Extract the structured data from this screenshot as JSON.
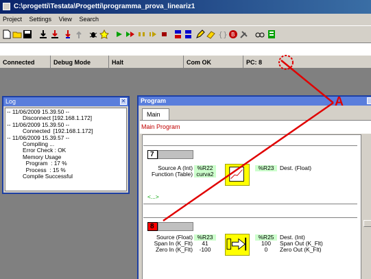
{
  "window": {
    "title": "C:\\progetti\\Testata\\Progetti\\programma_prova_lineariz1"
  },
  "menu": [
    "Project",
    "Settings",
    "View",
    "Search"
  ],
  "toolbar": {
    "icons": [
      "new-file-icon",
      "open-folder-icon",
      "save-icon",
      "download-icon",
      "download-options-icon",
      "compile-icon",
      "upload-icon",
      "debug-bug-icon",
      "star-icon",
      "run-icon",
      "step-icon",
      "pause-icon",
      "step-over-icon",
      "stop-icon",
      "breakpoint-icon",
      "breakpoint-clear-icon",
      "pencil-icon",
      "eraser-icon",
      "brackets-icon",
      "record-icon",
      "tools-icon",
      "watch-icon",
      "monitor-icon"
    ]
  },
  "status": {
    "connection": "Connected",
    "mode": "Debug Mode",
    "state": "Halt",
    "com": "Com OK",
    "pc": "PC: 8"
  },
  "log": {
    "title": "Log",
    "lines": "-- 11/06/2009 15.39.50 --\n          Disconnect [192.168.1.172]\n-- 11/06/2009 15.39.50 --\n          Connected  [192.168.1.172]\n-- 11/06/2009 15.39.57 --\n          Compiling ...\n          Error Check : OK\n          Memory Usage\n            Program  : 17 %\n            Process  : 15 %\n          Compile Successful"
  },
  "program": {
    "title": "Program",
    "tab": "Main",
    "header": "Main Program",
    "block7": {
      "number": "7",
      "labels": [
        "Source A (Int)",
        "Function (Table)"
      ],
      "inputs": [
        "%R22",
        "curva2"
      ],
      "output": "%R23",
      "output_label": "Dest. (Float)",
      "loop_marker": "<...>"
    },
    "block8": {
      "number": "8",
      "labels": [
        "Source (Float)",
        "Span In (K_Flt)",
        "Zero In (K_Flt)"
      ],
      "inputs": [
        "%R23",
        "41",
        "-100"
      ],
      "outputs": [
        "%R25",
        "100",
        "0"
      ],
      "output_labels": [
        "Dest. (Int)",
        "Span Out (K_Flt)",
        "Zero Out (K_Flt)"
      ]
    }
  },
  "annotation": {
    "label": "A",
    "color": "#e00000"
  },
  "colors": {
    "title_gradient_start": "#0a246a",
    "title_gradient_end": "#3a6ea5",
    "panel": "#d4d0c8",
    "active_var": "#ccffcc",
    "function_block": "#ffff00",
    "active_block_number": "#ff0000"
  }
}
